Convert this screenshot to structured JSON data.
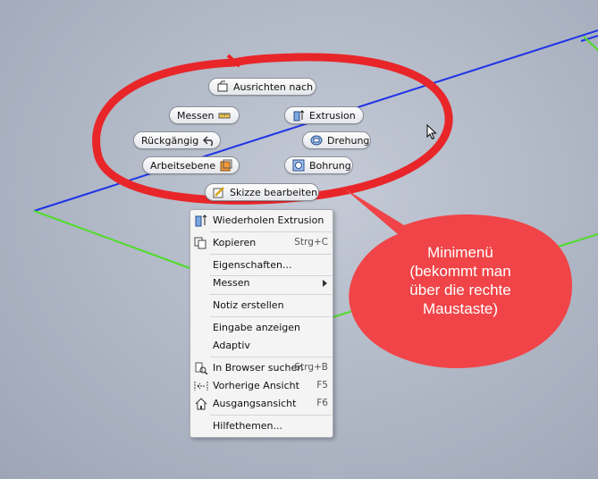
{
  "minimenu": {
    "ausrichten": "Ausrichten nach",
    "messen": "Messen",
    "extrusion": "Extrusion",
    "rueckgaengig": "Rückgängig",
    "drehung": "Drehung",
    "arbeitsebene": "Arbeitsebene",
    "bohrung": "Bohrung",
    "skizze": "Skizze bearbeiten"
  },
  "context_menu": {
    "items": [
      {
        "label": "Wiederholen Extrusion",
        "shortcut": ""
      },
      {
        "label": "Kopieren",
        "shortcut": "Strg+C"
      },
      {
        "label": "Eigenschaften...",
        "shortcut": ""
      },
      {
        "label": "Messen",
        "shortcut": ""
      },
      {
        "label": "Notiz erstellen",
        "shortcut": ""
      },
      {
        "label": "Eingabe anzeigen",
        "shortcut": ""
      },
      {
        "label": "Adaptiv",
        "shortcut": ""
      },
      {
        "label": "In Browser suchen",
        "shortcut": "Strg+B"
      },
      {
        "label": "Vorherige Ansicht",
        "shortcut": "F5"
      },
      {
        "label": "Ausgangsansicht",
        "shortcut": "F6"
      },
      {
        "label": "Hilfethemen...",
        "shortcut": ""
      }
    ]
  },
  "callout": {
    "lines": [
      "Minimenü",
      "(bekommt man",
      "über die rechte",
      "Maustaste)"
    ]
  },
  "colors": {
    "annotation_red": "#e8262a",
    "bubble_red": "#f04448",
    "plane_blue": "#1f33e6",
    "plane_green": "#4fdc2a"
  }
}
